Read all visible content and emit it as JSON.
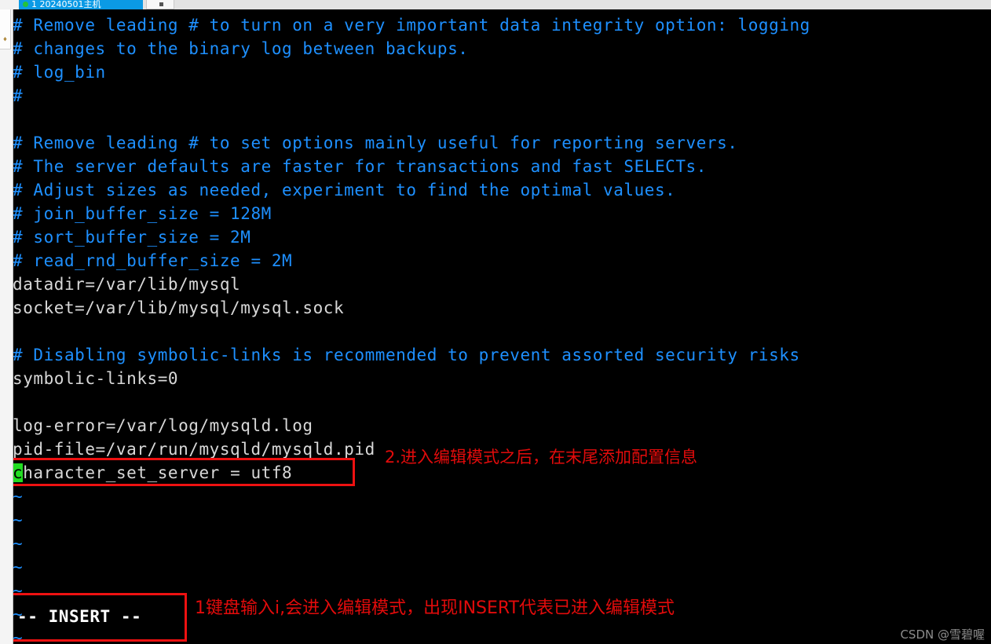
{
  "window": {
    "tab": {
      "label": "1 20240501主机",
      "status_dot": "connected-dot",
      "new_tab_label": "+"
    },
    "siderail": {
      "icon": "bookmark-icon"
    }
  },
  "terminal": {
    "lines": [
      {
        "text": "# Remove leading # to turn on a very important data integrity option: logging",
        "style": "comment"
      },
      {
        "text": "# changes to the binary log between backups.",
        "style": "comment"
      },
      {
        "text": "# log_bin",
        "style": "comment"
      },
      {
        "text": "#",
        "style": "comment"
      },
      {
        "text": "",
        "style": "plain"
      },
      {
        "text": "# Remove leading # to set options mainly useful for reporting servers.",
        "style": "comment"
      },
      {
        "text": "# The server defaults are faster for transactions and fast SELECTs.",
        "style": "comment"
      },
      {
        "text": "# Adjust sizes as needed, experiment to find the optimal values.",
        "style": "comment"
      },
      {
        "text": "# join_buffer_size = 128M",
        "style": "comment"
      },
      {
        "text": "# sort_buffer_size = 2M",
        "style": "comment"
      },
      {
        "text": "# read_rnd_buffer_size = 2M",
        "style": "comment"
      },
      {
        "text": "datadir=/var/lib/mysql",
        "style": "plain"
      },
      {
        "text": "socket=/var/lib/mysql/mysql.sock",
        "style": "plain"
      },
      {
        "text": "",
        "style": "plain"
      },
      {
        "text": "# Disabling symbolic-links is recommended to prevent assorted security risks",
        "style": "comment"
      },
      {
        "text": "symbolic-links=0",
        "style": "plain"
      },
      {
        "text": "",
        "style": "plain"
      },
      {
        "text": "log-error=/var/log/mysqld.log",
        "style": "plain"
      },
      {
        "text": "pid-file=/var/run/mysqld/mysqld.pid",
        "style": "plain"
      }
    ],
    "cursor_line": {
      "cursor_char": "c",
      "rest": "haracter_set_server = utf8",
      "full_text": "character_set_server = utf8",
      "style": "plain"
    },
    "empty_markers": [
      "~",
      "~",
      "~",
      "~",
      "~",
      "~",
      "~"
    ],
    "status_line": "-- INSERT --"
  },
  "annotations": {
    "step2": "2.进入编辑模式之后，在末尾添加配置信息",
    "step1": "1键盘输入i,会进入编辑模式，出现INSERT代表已进入编辑模式",
    "watermark": "CSDN @雪碧喔",
    "highlight_color": "#ee1111",
    "cursor_color": "#22dd22",
    "comment_color": "#1e90ff"
  }
}
